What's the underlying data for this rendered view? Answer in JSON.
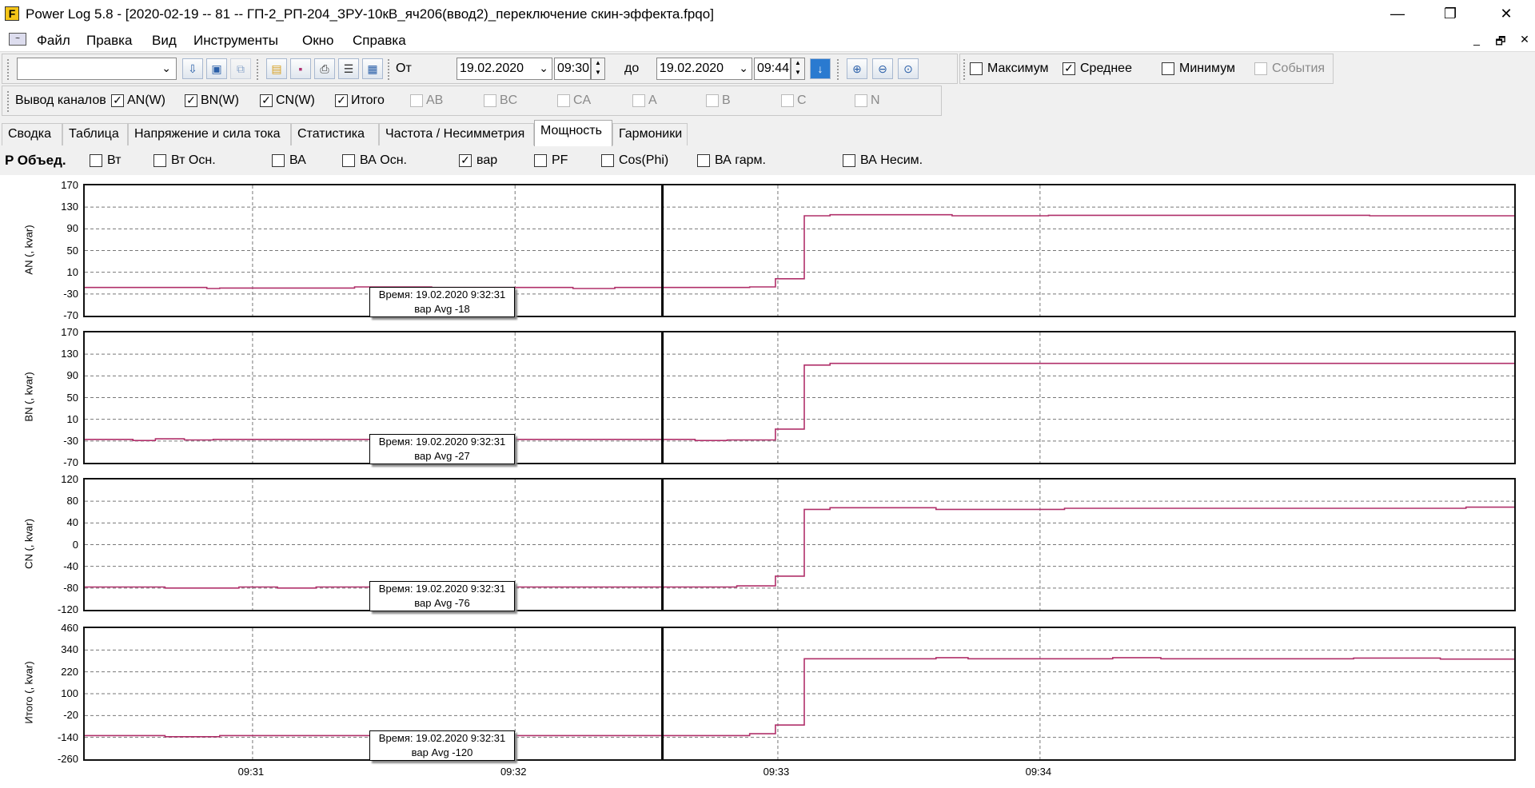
{
  "window": {
    "title": "Power Log 5.8 - [2020-02-19 -- 81 -- ГП-2_РП-204_ЗРУ-10кВ_яч206(ввод2)_переключение скин-эффекта.fpqo]",
    "app_icon_letter": "F",
    "minimize": "—",
    "maximize": "❐",
    "close": "✕"
  },
  "menu": {
    "items": [
      "Файл",
      "Правка",
      "Вид",
      "Инструменты",
      "Окно",
      "Справка"
    ],
    "mdi_minimize": "_",
    "mdi_restore": "🗗",
    "mdi_close": "✕"
  },
  "toolbar": {
    "from_label": "От",
    "from_date": "19.02.2020",
    "from_time": "09:30",
    "to_label": "до",
    "to_date": "19.02.2020",
    "to_time": "09:44",
    "options": [
      {
        "label": "Максимум",
        "checked": false,
        "disabled": false
      },
      {
        "label": "Среднее",
        "checked": true,
        "disabled": false
      },
      {
        "label": "Минимум",
        "checked": false,
        "disabled": false
      },
      {
        "label": "События",
        "checked": false,
        "disabled": true
      }
    ]
  },
  "channels": {
    "label": "Вывод каналов",
    "items": [
      {
        "label": "AN(W)",
        "checked": true,
        "disabled": false
      },
      {
        "label": "BN(W)",
        "checked": true,
        "disabled": false
      },
      {
        "label": "CN(W)",
        "checked": true,
        "disabled": false
      },
      {
        "label": "Итого",
        "checked": true,
        "disabled": false
      },
      {
        "label": "AB",
        "checked": false,
        "disabled": true
      },
      {
        "label": "BC",
        "checked": false,
        "disabled": true
      },
      {
        "label": "CA",
        "checked": false,
        "disabled": true
      },
      {
        "label": "A",
        "checked": false,
        "disabled": true
      },
      {
        "label": "B",
        "checked": false,
        "disabled": true
      },
      {
        "label": "C",
        "checked": false,
        "disabled": true
      },
      {
        "label": "N",
        "checked": false,
        "disabled": true
      }
    ]
  },
  "tabs": [
    {
      "label": "Сводка",
      "active": false
    },
    {
      "label": "Таблица",
      "active": false
    },
    {
      "label": "Напряжение и сила тока",
      "active": false
    },
    {
      "label": "Статистика",
      "active": false
    },
    {
      "label": "Частота / Несимметрия",
      "active": false
    },
    {
      "label": "Мощность",
      "active": true
    },
    {
      "label": "Гармоники",
      "active": false
    }
  ],
  "power": {
    "label": "P Объед.",
    "options": [
      {
        "label": "Вт",
        "checked": false
      },
      {
        "label": "Вт Осн.",
        "checked": false
      },
      {
        "label": "ВА",
        "checked": false
      },
      {
        "label": "ВА Осн.",
        "checked": false
      },
      {
        "label": "вар",
        "checked": true
      },
      {
        "label": "PF",
        "checked": false
      },
      {
        "label": "Cos(Phi)",
        "checked": false
      },
      {
        "label": "ВА гарм.",
        "checked": false
      },
      {
        "label": "ВА Несим.",
        "checked": false
      }
    ]
  },
  "colors": {
    "series": "#b0306a",
    "cursor": "#000000",
    "grid": "#777777"
  },
  "chart_data": [
    {
      "type": "line",
      "ylabel": "AN (, kvar)",
      "yticks": [
        "170",
        "130",
        "90",
        "50",
        "10",
        "-30",
        "-70"
      ],
      "ylim": [
        -70,
        170
      ],
      "xticks": [
        "09:31",
        "09:32",
        "09:33",
        "09:34"
      ],
      "cursor_time": "09:32:31",
      "tooltip": {
        "line1": "Время: 19.02.2020 9:32:31",
        "line2": "вар Avg -18"
      },
      "series": [
        {
          "name": "вар Avg",
          "values": [
            [
              0,
              -18
            ],
            [
              0.38,
              -18
            ],
            [
              0.38,
              -20
            ],
            [
              0.42,
              -20
            ],
            [
              0.42,
              -19
            ],
            [
              0.84,
              -19
            ],
            [
              0.84,
              -17
            ],
            [
              1.08,
              -17
            ],
            [
              1.08,
              -18
            ],
            [
              1.52,
              -18
            ],
            [
              1.52,
              -20
            ],
            [
              1.65,
              -20
            ],
            [
              1.65,
              -18
            ],
            [
              2.07,
              -18
            ],
            [
              2.07,
              -17
            ],
            [
              2.15,
              -17
            ],
            [
              2.15,
              -2
            ],
            [
              2.24,
              -2
            ],
            [
              2.24,
              114
            ],
            [
              2.32,
              114
            ],
            [
              2.32,
              116
            ],
            [
              2.7,
              116
            ],
            [
              2.7,
              114
            ],
            [
              3.0,
              114
            ],
            [
              3.0,
              115
            ],
            [
              4.0,
              115
            ],
            [
              4.0,
              114
            ],
            [
              4.45,
              114
            ]
          ]
        }
      ]
    },
    {
      "type": "line",
      "ylabel": "BN (, kvar)",
      "yticks": [
        "170",
        "130",
        "90",
        "50",
        "10",
        "-30",
        "-70"
      ],
      "ylim": [
        -70,
        170
      ],
      "xticks": [
        "09:31",
        "09:32",
        "09:33",
        "09:34"
      ],
      "cursor_time": "09:32:31",
      "tooltip": {
        "line1": "Время: 19.02.2020 9:32:31",
        "line2": "вар Avg -27"
      },
      "series": [
        {
          "name": "вар Avg",
          "values": [
            [
              0,
              -27
            ],
            [
              0.15,
              -27
            ],
            [
              0.15,
              -29
            ],
            [
              0.22,
              -29
            ],
            [
              0.22,
              -26
            ],
            [
              0.31,
              -26
            ],
            [
              0.31,
              -28
            ],
            [
              0.4,
              -28
            ],
            [
              0.4,
              -27
            ],
            [
              1.9,
              -27
            ],
            [
              1.9,
              -29
            ],
            [
              2.0,
              -29
            ],
            [
              2.0,
              -28
            ],
            [
              2.15,
              -28
            ],
            [
              2.15,
              -8
            ],
            [
              2.24,
              -8
            ],
            [
              2.24,
              110
            ],
            [
              2.32,
              110
            ],
            [
              2.32,
              113
            ],
            [
              4.45,
              113
            ]
          ]
        }
      ]
    },
    {
      "type": "line",
      "ylabel": "CN (, kvar)",
      "yticks": [
        "120",
        "80",
        "40",
        "0",
        "-40",
        "-80",
        "-120"
      ],
      "ylim": [
        -120,
        120
      ],
      "xticks": [
        "09:31",
        "09:32",
        "09:33",
        "09:34"
      ],
      "cursor_time": "09:32:31",
      "tooltip": {
        "line1": "Время: 19.02.2020 9:32:31",
        "line2": "вар Avg -76"
      },
      "series": [
        {
          "name": "вар Avg",
          "values": [
            [
              0,
              -78
            ],
            [
              0.25,
              -78
            ],
            [
              0.25,
              -80
            ],
            [
              0.48,
              -80
            ],
            [
              0.48,
              -78
            ],
            [
              0.6,
              -78
            ],
            [
              0.6,
              -80
            ],
            [
              0.72,
              -80
            ],
            [
              0.72,
              -78
            ],
            [
              2.03,
              -78
            ],
            [
              2.03,
              -76
            ],
            [
              2.15,
              -76
            ],
            [
              2.15,
              -58
            ],
            [
              2.24,
              -58
            ],
            [
              2.24,
              65
            ],
            [
              2.32,
              65
            ],
            [
              2.32,
              68
            ],
            [
              2.65,
              68
            ],
            [
              2.65,
              65
            ],
            [
              3.05,
              65
            ],
            [
              3.05,
              67
            ],
            [
              4.3,
              67
            ],
            [
              4.3,
              69
            ],
            [
              4.45,
              69
            ]
          ]
        }
      ]
    },
    {
      "type": "line",
      "ylabel": "Итого (, kvar)",
      "yticks": [
        "460",
        "340",
        "220",
        "100",
        "-20",
        "-140",
        "-260"
      ],
      "ylim": [
        -260,
        460
      ],
      "xticks": [
        "09:31",
        "09:32",
        "09:33",
        "09:34"
      ],
      "cursor_time": "09:32:31",
      "tooltip": {
        "line1": "Время: 19.02.2020 9:32:31",
        "line2": "вар Avg -120"
      },
      "series": [
        {
          "name": "вар Avg",
          "values": [
            [
              0,
              -130
            ],
            [
              0.25,
              -130
            ],
            [
              0.25,
              -136
            ],
            [
              0.42,
              -136
            ],
            [
              0.42,
              -130
            ],
            [
              2.07,
              -130
            ],
            [
              2.07,
              -120
            ],
            [
              2.15,
              -120
            ],
            [
              2.15,
              -72
            ],
            [
              2.24,
              -72
            ],
            [
              2.24,
              292
            ],
            [
              2.65,
              292
            ],
            [
              2.65,
              298
            ],
            [
              2.75,
              298
            ],
            [
              2.75,
              292
            ],
            [
              3.2,
              292
            ],
            [
              3.2,
              298
            ],
            [
              3.35,
              298
            ],
            [
              3.35,
              292
            ],
            [
              3.95,
              292
            ],
            [
              3.95,
              296
            ],
            [
              4.22,
              296
            ],
            [
              4.22,
              290
            ],
            [
              4.45,
              290
            ]
          ]
        }
      ]
    }
  ]
}
